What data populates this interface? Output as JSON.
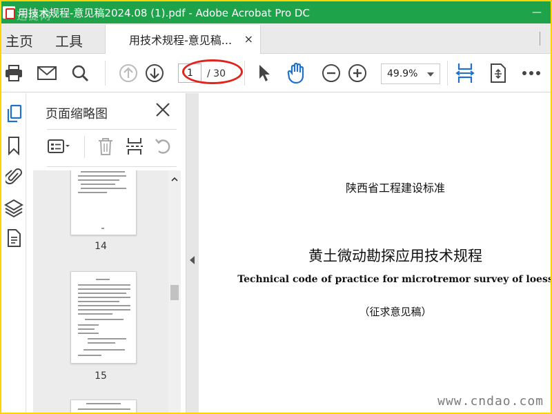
{
  "window": {
    "title": "用技术规程-意见稿2024.08 (1).pdf - Adobe Acrobat Pro DC",
    "minimize": "—",
    "watermark": "迅捷网"
  },
  "tabs": {
    "home": "主页",
    "tools": "工具",
    "document": "用技术规程-意见稿...",
    "close": "×"
  },
  "toolbar": {
    "current_page": "1",
    "total_pages": "/ 30",
    "zoom": "49.9%",
    "icons": [
      "print-icon",
      "email-icon",
      "search-icon",
      "prev-page-icon",
      "next-page-icon",
      "select-cursor-icon",
      "hand-icon",
      "zoom-out-icon",
      "zoom-in-icon",
      "fit-page-icon",
      "rotate-page-icon",
      "more-icon"
    ]
  },
  "rail": {
    "icons": [
      "page-thumbnails-icon",
      "bookmark-icon",
      "attachment-icon",
      "layers-icon",
      "document-properties-icon"
    ]
  },
  "thumbnail_panel": {
    "title": "页面缩略图",
    "pages": [
      {
        "number": "14"
      },
      {
        "number": "15"
      }
    ]
  },
  "document": {
    "line1": "陕西省工程建设标准",
    "title_cn": "黄土微动勘探应用技术规程",
    "title_en": "Technical code of practice for microtremor survey of loess",
    "status": "（征求意见稿）",
    "watermark": "www.cndao.com"
  },
  "colors": {
    "titlebar": "#1fa34a",
    "frame": "#ffd400",
    "accent_blue": "#1f6fcf",
    "annotation_red": "#e0231c"
  }
}
